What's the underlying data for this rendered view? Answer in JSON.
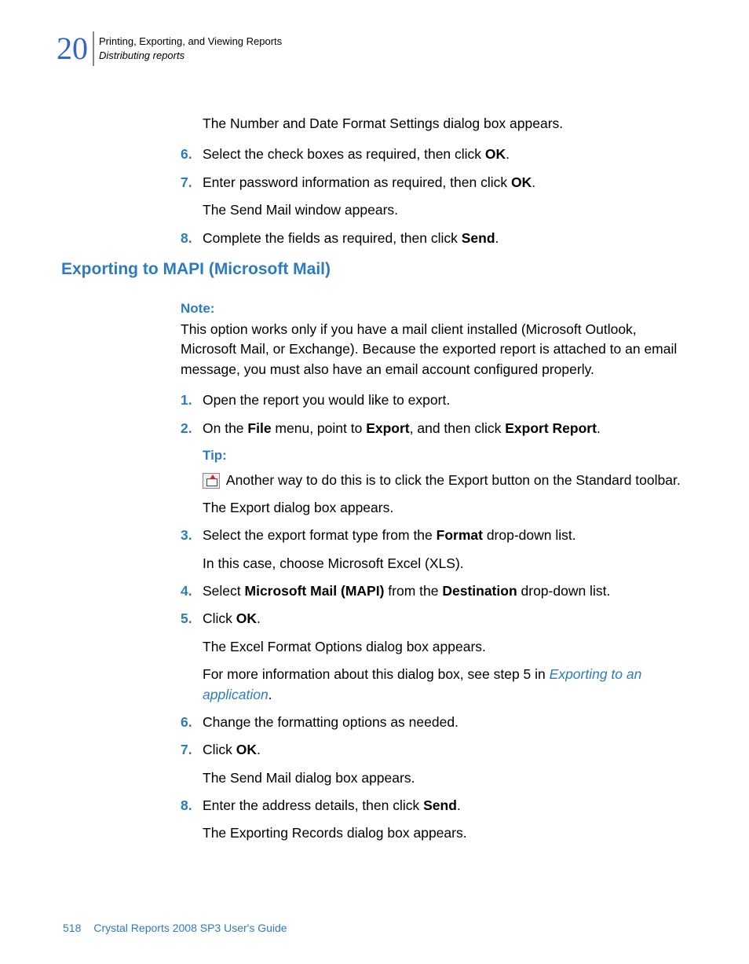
{
  "chapter_number": "20",
  "header": {
    "top": "Printing, Exporting, and Viewing Reports",
    "bottom": "Distributing reports"
  },
  "top_block": {
    "p1": "The Number and Date Format Settings dialog box appears.",
    "li6_num": "6.",
    "li6_a": "Select the check boxes as required, then click ",
    "li6_b": "OK",
    "li6_c": ".",
    "li7_num": "7.",
    "li7_a": "Enter password information as required, then click ",
    "li7_b": "OK",
    "li7_c": ".",
    "li7_sub": "The Send Mail window appears.",
    "li8_num": "8.",
    "li8_a": "Complete the fields as required, then click ",
    "li8_b": "Send",
    "li8_c": "."
  },
  "heading": "Exporting to MAPI (Microsoft Mail)",
  "section": {
    "note_label": "Note:",
    "note_body": "This option works only if you have a mail client installed (Microsoft Outlook, Microsoft Mail, or Exchange). Because the exported report is attached to an email message, you must also have an email account configured properly.",
    "li1_num": "1.",
    "li1": "Open the report you would like to export.",
    "li2_num": "2.",
    "li2_a": "On the ",
    "li2_b": "File",
    "li2_c": " menu, point to ",
    "li2_d": "Export",
    "li2_e": ", and then click ",
    "li2_f": "Export Report",
    "li2_g": ".",
    "tip_label": "Tip:",
    "tip_body": " Another way to do this is to click the Export button on the Standard toolbar.",
    "tip_sub": "The Export dialog box appears.",
    "li3_num": "3.",
    "li3_a": "Select the export format type from the ",
    "li3_b": "Format",
    "li3_c": " drop-down list.",
    "li3_sub": "In this case, choose Microsoft Excel (XLS).",
    "li4_num": "4.",
    "li4_a": "Select ",
    "li4_b": "Microsoft Mail (MAPI)",
    "li4_c": " from the ",
    "li4_d": "Destination",
    "li4_e": " drop-down list.",
    "li5_num": "5.",
    "li5_a": "Click ",
    "li5_b": "OK",
    "li5_c": ".",
    "li5_sub1": "The Excel Format Options dialog box appears.",
    "li5_sub2_a": "For more information about this dialog box, see step 5 in ",
    "li5_sub2_link": "Exporting to an application",
    "li5_sub2_b": ".",
    "li6_num": "6.",
    "li6": "Change the formatting options as needed.",
    "li7_num": "7.",
    "li7_a": "Click ",
    "li7_b": "OK",
    "li7_c": ".",
    "li7_sub": "The Send Mail dialog box appears.",
    "li8_num": "8.",
    "li8_a": "Enter the address details, then click ",
    "li8_b": "Send",
    "li8_c": ".",
    "li8_sub": "The Exporting Records dialog box appears."
  },
  "footer": {
    "page": "518",
    "title": "Crystal Reports 2008 SP3 User's Guide"
  }
}
